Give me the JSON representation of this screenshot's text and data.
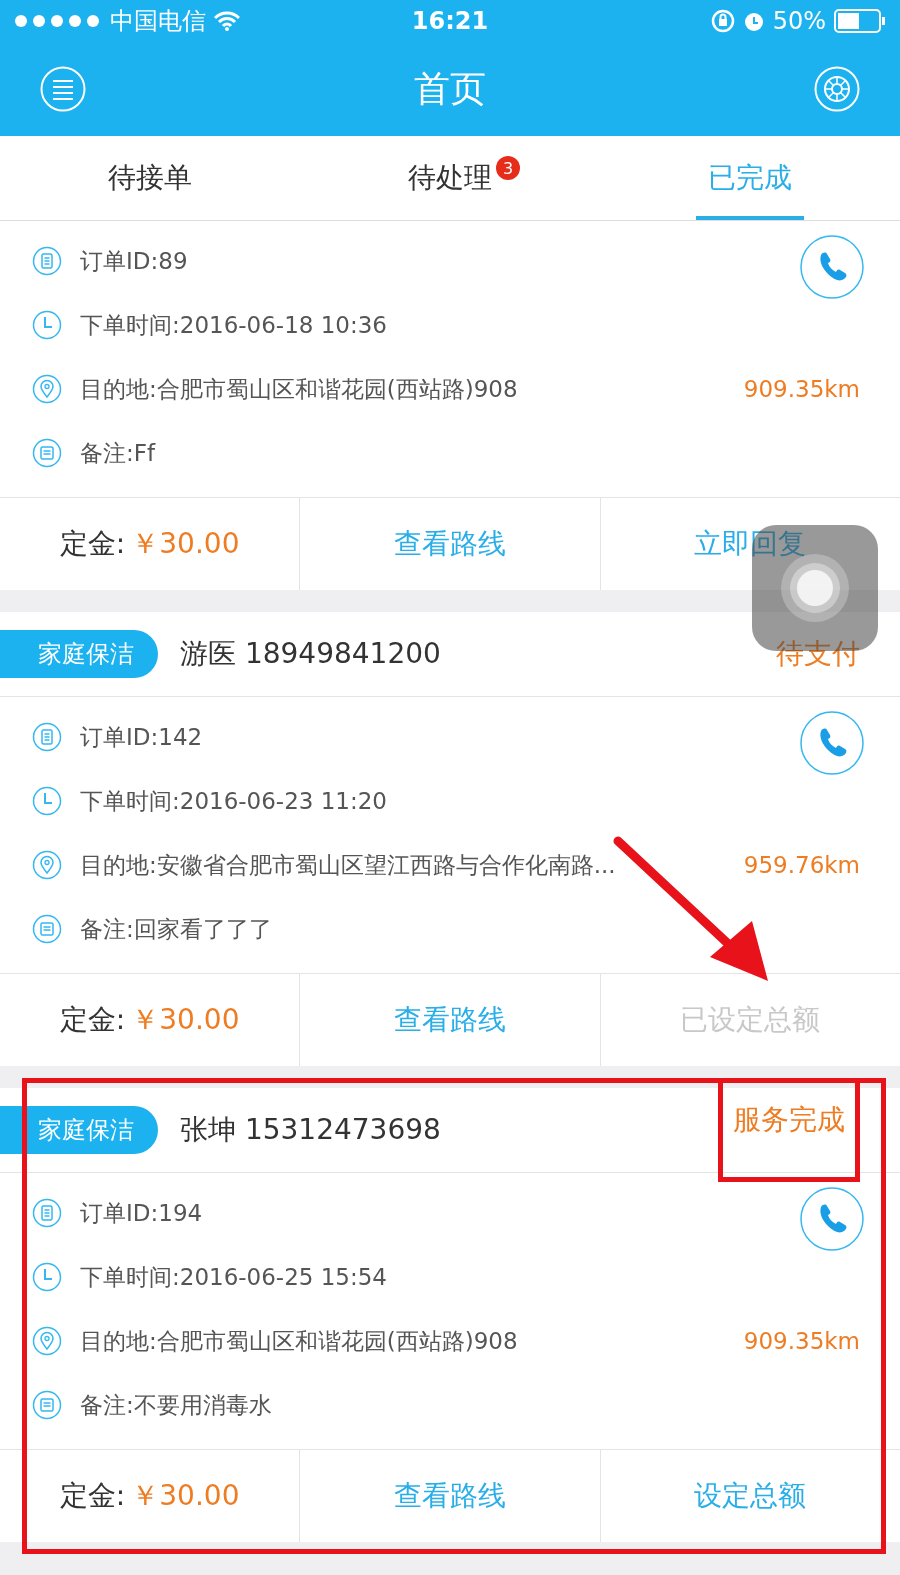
{
  "status_bar": {
    "carrier": "中国电信",
    "time": "16:21",
    "battery": "50%"
  },
  "nav": {
    "title": "首页"
  },
  "tabs": [
    {
      "label": "待接单",
      "selected": false
    },
    {
      "label": "待处理",
      "selected": false,
      "badge": "3"
    },
    {
      "label": "已完成",
      "selected": true
    }
  ],
  "orders": [
    {
      "order_id": "订单ID:89",
      "time": "下单时间:2016-06-18 10:36",
      "destination": "目的地:合肥市蜀山区和谐花园(西站路)908",
      "distance": "909.35km",
      "remark": "备注:Ff",
      "deposit_label": "定金:",
      "deposit": "￥30.00",
      "actions": [
        {
          "label": "查看路线",
          "disabled": false
        },
        {
          "label": "立即回复",
          "disabled": false
        }
      ],
      "highlighted": false
    },
    {
      "header": {
        "tag": "家庭保洁",
        "customer": "游医 18949841200",
        "status": "待支付"
      },
      "order_id": "订单ID:142",
      "time": "下单时间:2016-06-23 11:20",
      "destination": "目的地:安徽省合肥市蜀山区望江西路与合作化南路...",
      "distance": "959.76km",
      "remark": "备注:回家看了了了",
      "deposit_label": "定金:",
      "deposit": "￥30.00",
      "actions": [
        {
          "label": "查看路线",
          "disabled": false
        },
        {
          "label": "已设定总额",
          "disabled": true
        }
      ],
      "highlighted": false
    },
    {
      "header": {
        "tag": "家庭保洁",
        "customer": "张坤 15312473698",
        "status": "服务完成"
      },
      "order_id": "订单ID:194",
      "time": "下单时间:2016-06-25 15:54",
      "destination": "目的地:合肥市蜀山区和谐花园(西站路)908",
      "distance": "909.35km",
      "remark": "备注:不要用消毒水",
      "deposit_label": "定金:",
      "deposit": "￥30.00",
      "actions": [
        {
          "label": "查看路线",
          "disabled": false
        },
        {
          "label": "设定总额",
          "disabled": false
        }
      ],
      "highlighted": true
    }
  ]
}
